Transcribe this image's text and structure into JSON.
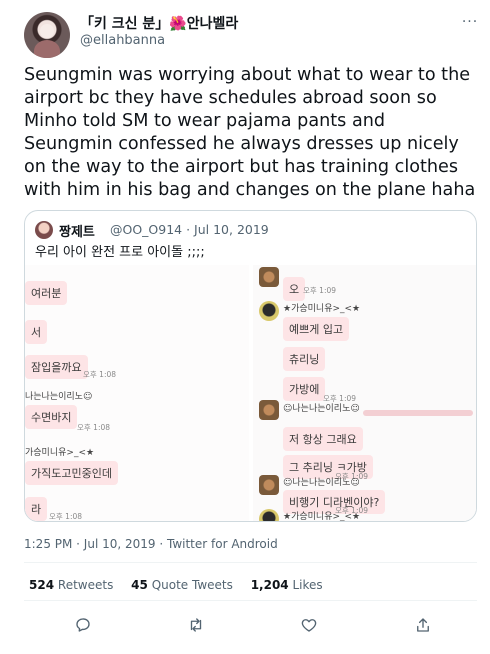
{
  "author": {
    "display_name": "「키 크신 분」🌺안나벨라",
    "handle": "@ellahbanna"
  },
  "menu": {
    "more_label": "···"
  },
  "tweet_text": "Seungmin was worrying about what to wear to the airport bc they have schedules abroad soon so Minho told SM to wear pajama pants and Seungmin confessed he always dresses up nicely on the way to the airport but has training clothes with him in his bag and changes on the plane haha",
  "quote": {
    "display_name": "짱제트",
    "handle_date": "@OO_O914 · Jul 10, 2019",
    "text": "우리 아이 완전 프로 아이돌 ;;;;",
    "left_chat": {
      "bubbles": [
        "여러분",
        "서",
        "잠입을까요",
        "수면바지",
        "가직도고민중인데",
        "라"
      ],
      "nick_1": "나는나는이리노☺",
      "nick_2": "가승미니유>_<★",
      "times": [
        "오후 1:08",
        "오후 1:08",
        "오후 1:08"
      ]
    },
    "right_chat": {
      "top_bubble": "오",
      "nick_1": "★가승미니유>_<★",
      "bubbles_1": [
        "예쁘게 입고",
        "츄리닝",
        "가방에"
      ],
      "nick_2": "☺나는나는이리노☺",
      "bubbles_2": [
        "저 항상 그래요",
        "그 추리닝 ㅋ가방"
      ],
      "nick_3": "☺나는나는이리노☺",
      "bubble_3": "비행기 디라벤이야?",
      "nick_4": "★가승미니유>_<★",
      "bubble_4": "안에",
      "times": [
        "오후 1:09",
        "오후 1:09",
        "오후 1:09",
        "오후 1:09"
      ]
    }
  },
  "timestamp": "1:25 PM · Jul 10, 2019 · Twitter for Android",
  "stats": {
    "retweets_count": "524",
    "retweets_label": "Retweets",
    "quotes_count": "45",
    "quotes_label": "Quote Tweets",
    "likes_count": "1,204",
    "likes_label": "Likes"
  },
  "icons": {
    "reply": "reply-icon",
    "retweet": "retweet-icon",
    "like": "like-icon",
    "share": "share-icon"
  },
  "colors": {
    "text": "#0f1419",
    "secondary": "#536471",
    "border": "#cfd9de",
    "chat_bubble": "#fde4e6"
  }
}
